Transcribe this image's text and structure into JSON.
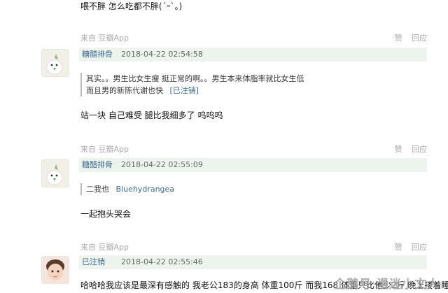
{
  "comments": [
    {
      "body": "喂不胖 怎么吃都不胖(´ｰ`。)",
      "source": "来自 豆瓣App",
      "like_label": "赞",
      "reply_label": "回应"
    },
    {
      "username": "糖醋排骨",
      "time": "2018-04-22 02:54:58",
      "quote_line1": "其实。。男生比女生瘦 挺正常的啊。。男生本来体脂率就比女生低",
      "quote_line2": "而且男的新陈代谢也快",
      "quote_author": "[已注销]",
      "body": "站一块 自己难受 腿比我细多了 呜呜呜",
      "source": "来自 豆瓣App",
      "like_label": "赞",
      "reply_label": "回应"
    },
    {
      "username": "糖醋排骨",
      "time": "2018-04-22 02:55:09",
      "quote_line1": "二我也",
      "quote_author": "Bluehydrangea",
      "body": "一起抱头哭会",
      "source": "来自 豆瓣App",
      "like_label": "赞",
      "reply_label": "回应"
    },
    {
      "username": "已注销",
      "time": "2018-04-22 02:55:46",
      "body": "哈哈哈我应该是最深有感触的 我老公183的身高 体重100斤 而我168 体重只比他少2斤 晚上搂着睡"
    }
  ],
  "watermark": "企鹅号 漫迷小文人"
}
